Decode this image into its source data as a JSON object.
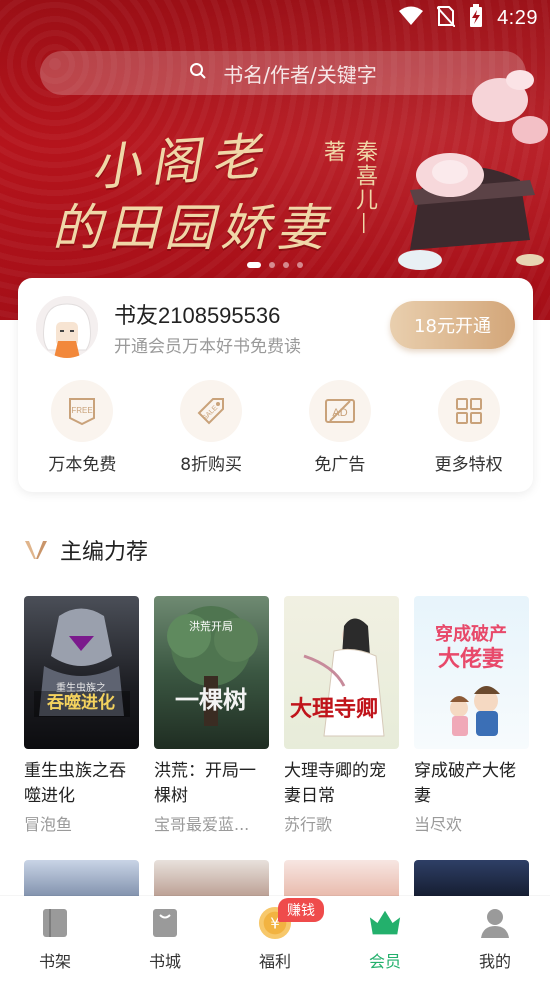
{
  "status": {
    "time": "4:29"
  },
  "search": {
    "placeholder": "书名/作者/关键字"
  },
  "banner": {
    "title_line1": "小阁老",
    "title_line2": "的田园娇妻",
    "author": "秦喜儿—著"
  },
  "member": {
    "username": "书友2108595536",
    "subtitle": "开通会员万本好书免费读",
    "open_button": "18元开通",
    "perks": [
      {
        "label": "万本免费",
        "icon": "free-icon"
      },
      {
        "label": "8折购买",
        "icon": "sale-tag-icon"
      },
      {
        "label": "免广告",
        "icon": "no-ad-icon"
      },
      {
        "label": "更多特权",
        "icon": "grid-icon"
      }
    ]
  },
  "section": {
    "title": "主编力荐"
  },
  "books": [
    {
      "title": "重生虫族之吞噬进化",
      "author": "冒泡鱼"
    },
    {
      "title": "洪荒：开局一棵树",
      "author": "宝哥最爱蓝..."
    },
    {
      "title": "大理寺卿的宠妻日常",
      "author": "苏行歌"
    },
    {
      "title": "穿成破产大佬妻",
      "author": "当尽欢"
    }
  ],
  "nav": {
    "items": [
      {
        "label": "书架",
        "icon": "bookshelf-icon"
      },
      {
        "label": "书城",
        "icon": "bookstore-icon"
      },
      {
        "label": "福利",
        "icon": "coin-icon",
        "badge": "赚钱"
      },
      {
        "label": "会员",
        "icon": "crown-icon",
        "active": true
      },
      {
        "label": "我的",
        "icon": "user-icon"
      }
    ]
  },
  "colors": {
    "accent_green": "#23b06c",
    "banner_red": "#b5141c",
    "gold": "#d3a679"
  }
}
